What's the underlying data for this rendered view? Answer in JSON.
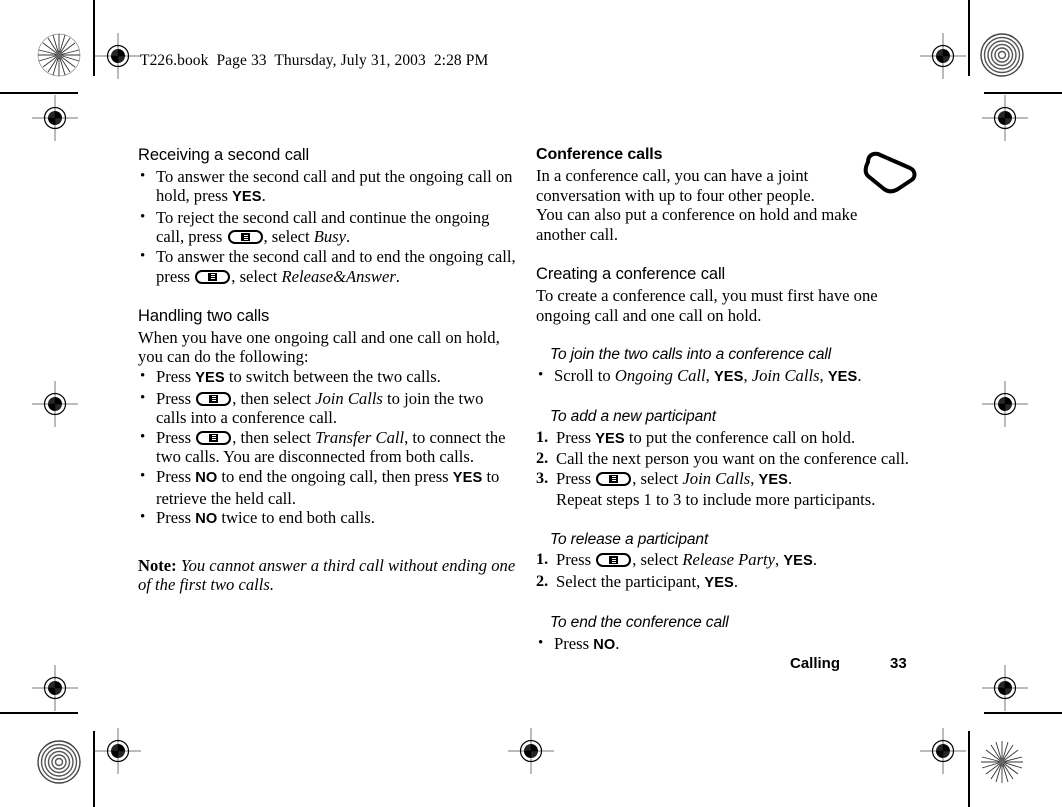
{
  "header": {
    "line": "T226.book  Page 33  Thursday, July 31, 2003  2:28 PM"
  },
  "footer": {
    "chapter": "Calling",
    "page_number": "33"
  },
  "icons": {
    "menu_key": "menu-key-icon",
    "phone": "phone-outline-icon",
    "registration": "registration-target-icon",
    "sunburst": "sunburst-density-icon"
  },
  "left_column": {
    "section1": {
      "heading": "Receiving a second call",
      "bullets": [
        {
          "parts": [
            {
              "t": "text",
              "v": "To answer the second call and put the ongoing call on hold, press "
            },
            {
              "t": "ui",
              "v": "YES"
            },
            {
              "t": "text",
              "v": "."
            }
          ]
        },
        {
          "parts": [
            {
              "t": "text",
              "v": "To reject the second call and continue the ongoing call, press "
            },
            {
              "t": "key",
              "v": "menu-key-icon"
            },
            {
              "t": "text",
              "v": ", select "
            },
            {
              "t": "menu",
              "v": "Busy"
            },
            {
              "t": "text",
              "v": "."
            }
          ]
        },
        {
          "parts": [
            {
              "t": "text",
              "v": "To answer the second call and to end the ongoing call, press "
            },
            {
              "t": "key",
              "v": "menu-key-icon"
            },
            {
              "t": "text",
              "v": ", select "
            },
            {
              "t": "menu",
              "v": "Release&Answer"
            },
            {
              "t": "text",
              "v": "."
            }
          ]
        }
      ]
    },
    "section2": {
      "heading": "Handling two calls",
      "intro": "When you have one ongoing call and one call on hold, you can do the following:",
      "bullets": [
        {
          "parts": [
            {
              "t": "text",
              "v": "Press "
            },
            {
              "t": "ui",
              "v": "YES"
            },
            {
              "t": "text",
              "v": " to switch between the two calls."
            }
          ]
        },
        {
          "parts": [
            {
              "t": "text",
              "v": "Press "
            },
            {
              "t": "key",
              "v": "menu-key-icon"
            },
            {
              "t": "text",
              "v": ", then select "
            },
            {
              "t": "menu",
              "v": "Join Calls"
            },
            {
              "t": "text",
              "v": " to join the two calls into a conference call."
            }
          ]
        },
        {
          "parts": [
            {
              "t": "text",
              "v": "Press "
            },
            {
              "t": "key",
              "v": "menu-key-icon"
            },
            {
              "t": "text",
              "v": ", then select "
            },
            {
              "t": "menu",
              "v": "Transfer Call"
            },
            {
              "t": "text",
              "v": ", to connect the two calls. You are disconnected from both calls."
            }
          ]
        },
        {
          "parts": [
            {
              "t": "text",
              "v": "Press "
            },
            {
              "t": "ui",
              "v": "NO"
            },
            {
              "t": "text",
              "v": " to end the ongoing call, then press "
            },
            {
              "t": "ui",
              "v": "YES"
            },
            {
              "t": "text",
              "v": " to retrieve the held call."
            }
          ]
        },
        {
          "parts": [
            {
              "t": "text",
              "v": "Press "
            },
            {
              "t": "ui",
              "v": "NO"
            },
            {
              "t": "text",
              "v": " twice to end both calls."
            }
          ]
        }
      ]
    },
    "note": {
      "label": "Note:",
      "text": "You cannot answer a third call without ending one of the first two calls."
    }
  },
  "right_column": {
    "section1": {
      "heading": "Conference calls",
      "paragraphs": [
        "In a conference call, you can have a joint conversation with up to four other people.",
        "You can also put a conference on hold and make another call."
      ]
    },
    "section2": {
      "heading": "Creating a conference call",
      "paragraph": "To create a conference call, you must first have one ongoing call and one call on hold."
    },
    "task1": {
      "heading": "To join the two calls into a conference call",
      "bullets": [
        {
          "parts": [
            {
              "t": "text",
              "v": "Scroll to "
            },
            {
              "t": "menu",
              "v": "Ongoing Call"
            },
            {
              "t": "text",
              "v": ", "
            },
            {
              "t": "ui",
              "v": "YES"
            },
            {
              "t": "text",
              "v": ", "
            },
            {
              "t": "menu",
              "v": "Join Calls"
            },
            {
              "t": "text",
              "v": ", "
            },
            {
              "t": "ui",
              "v": "YES"
            },
            {
              "t": "text",
              "v": "."
            }
          ]
        }
      ]
    },
    "task2": {
      "heading": "To add a new participant",
      "steps": [
        {
          "num": "1.",
          "parts": [
            {
              "t": "text",
              "v": "Press "
            },
            {
              "t": "ui",
              "v": "YES"
            },
            {
              "t": "text",
              "v": " to put the conference call on hold."
            }
          ]
        },
        {
          "num": "2.",
          "parts": [
            {
              "t": "text",
              "v": "Call the next person you want on the conference call."
            }
          ]
        },
        {
          "num": "3.",
          "parts": [
            {
              "t": "text",
              "v": "Press "
            },
            {
              "t": "key",
              "v": "menu-key-icon"
            },
            {
              "t": "text",
              "v": ", select "
            },
            {
              "t": "menu",
              "v": "Join Calls"
            },
            {
              "t": "text",
              "v": ", "
            },
            {
              "t": "ui",
              "v": "YES"
            },
            {
              "t": "text",
              "v": "."
            }
          ]
        }
      ],
      "trailing": "Repeat steps 1 to 3 to include more participants."
    },
    "task3": {
      "heading": "To release a participant",
      "steps": [
        {
          "num": "1.",
          "parts": [
            {
              "t": "text",
              "v": "Press "
            },
            {
              "t": "key",
              "v": "menu-key-icon"
            },
            {
              "t": "text",
              "v": ", select "
            },
            {
              "t": "menu",
              "v": "Release Party"
            },
            {
              "t": "text",
              "v": ", "
            },
            {
              "t": "ui",
              "v": "YES"
            },
            {
              "t": "text",
              "v": "."
            }
          ]
        },
        {
          "num": "2.",
          "parts": [
            {
              "t": "text",
              "v": "Select the participant, "
            },
            {
              "t": "ui",
              "v": "YES"
            },
            {
              "t": "text",
              "v": "."
            }
          ]
        }
      ]
    },
    "task4": {
      "heading": "To end the conference call",
      "bullets": [
        {
          "parts": [
            {
              "t": "text",
              "v": "Press "
            },
            {
              "t": "ui",
              "v": "NO"
            },
            {
              "t": "text",
              "v": "."
            }
          ]
        }
      ]
    }
  }
}
